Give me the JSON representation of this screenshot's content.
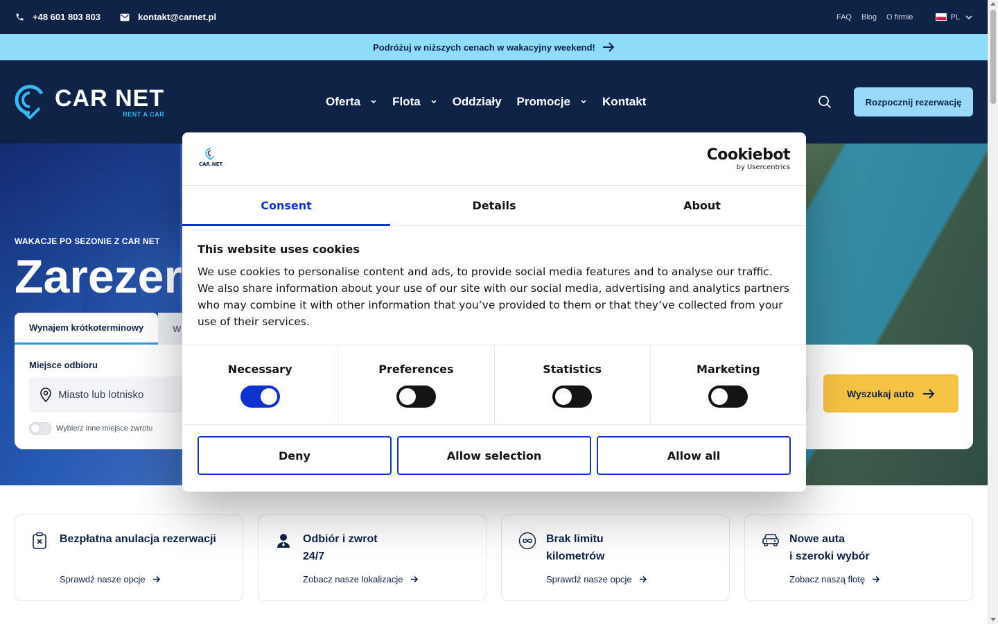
{
  "topbar": {
    "phone": "+48 601 803 803",
    "email": "kontakt@carnet.pl",
    "links": [
      "FAQ",
      "Blog",
      "O firmie"
    ],
    "language": "PL"
  },
  "promo": {
    "text": "Podróżuj w niższych cenach w wakacyjny weekend!"
  },
  "header": {
    "logo_main": "CAR NET",
    "logo_sub": "RENT A CAR",
    "nav": [
      "Oferta",
      "Flota",
      "Oddziały",
      "Promocje",
      "Kontakt"
    ],
    "cta": "Rozpocznij rezerwację"
  },
  "hero": {
    "kicker": "WAKACJE PO SEZONIE Z CAR NET",
    "title": "Zarezer",
    "tabs": [
      "Wynajem krótkoterminowy",
      "W"
    ],
    "pickup_label": "Miejsce odbioru",
    "pickup_placeholder": "Miasto lub lotnisko",
    "return_toggle": "Wybierz inne miejsce zwrotu",
    "search_button": "Wyszukaj auto"
  },
  "features": [
    {
      "title": "Bezpłatna anulacja rezerwacji",
      "link": "Sprawdź nasze opcje",
      "icon": "clipboard-x-icon"
    },
    {
      "title": "Odbiór i zwrot\n24/7",
      "link": "Zobacz nasze lokalizacje",
      "icon": "agent-icon"
    },
    {
      "title": "Brak limitu\nkilometrów",
      "link": "Sprawdź nasze opcje",
      "icon": "infinity-icon"
    },
    {
      "title": "Nowe auta\ni szeroki wybór",
      "link": "Zobacz naszą flotę",
      "icon": "car-icon"
    }
  ],
  "cookie": {
    "logo_text": "CAR.NET",
    "brand": "Cookiebot",
    "brand_sub": "by Usercentrics",
    "tabs": [
      "Consent",
      "Details",
      "About"
    ],
    "heading": "This website uses cookies",
    "body": "We use cookies to personalise content and ads, to provide social media features and to analyse our traffic. We also share information about your use of our site with our social media, advertising and analytics partners who may combine it with other information that you’ve provided to them or that they’ve collected from your use of their services.",
    "categories": [
      {
        "label": "Necessary",
        "checked": true
      },
      {
        "label": "Preferences",
        "checked": false
      },
      {
        "label": "Statistics",
        "checked": false
      },
      {
        "label": "Marketing",
        "checked": false
      }
    ],
    "buttons": {
      "deny": "Deny",
      "allow_selection": "Allow selection",
      "allow_all": "Allow all"
    }
  },
  "colors": {
    "navy": "#0f2346",
    "sky": "#8fdcfb",
    "accent_blue": "#1032cf",
    "yellow": "#f6c344"
  }
}
